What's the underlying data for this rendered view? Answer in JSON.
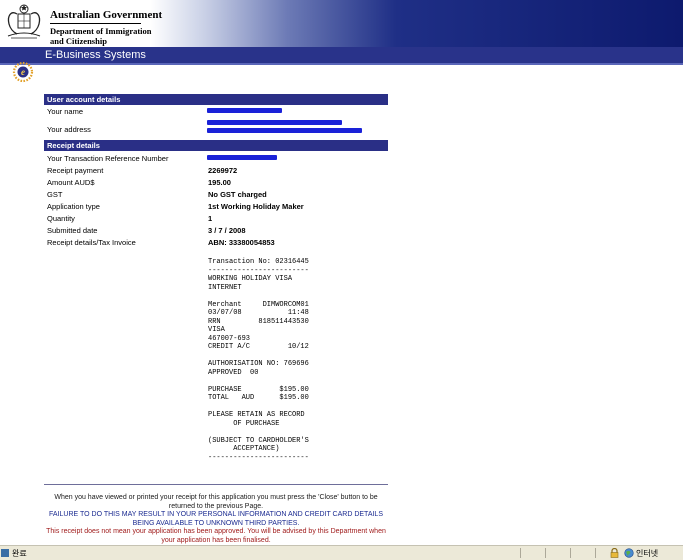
{
  "header": {
    "gov_line1": "Australian Government",
    "gov_line2a": "Department of Immigration",
    "gov_line2b": "and Citizenship",
    "system_title": "E-Business Systems"
  },
  "account": {
    "title": "User account details",
    "name_label": "Your name",
    "address_label": "Your address"
  },
  "receipt": {
    "title": "Receipt details",
    "rows": [
      {
        "label": "Your Transaction Reference Number",
        "value": ""
      },
      {
        "label": "Receipt payment",
        "value": "2269972"
      },
      {
        "label": "Amount AUD$",
        "value": "195.00"
      },
      {
        "label": "GST",
        "value": "No GST charged"
      },
      {
        "label": "Application type",
        "value": "1st Working Holiday Maker"
      },
      {
        "label": "Quantity",
        "value": "1"
      },
      {
        "label": "Submitted date",
        "value": "3 / 7 / 2008"
      },
      {
        "label": "Receipt details/Tax Invoice",
        "value": "ABN: 33380054853"
      }
    ],
    "text": "Transaction No: 02316445\n------------------------\nWORKING HOLIDAY VISA\nINTERNET\n\nMerchant     DIMWORCOM01\n03/07/08           11:48\nRRN         818511443530\nVISA\n467007-693\nCREDIT A/C         10/12\n\nAUTHORISATION NO: 769696\nAPPROVED  00\n\nPURCHASE         $195.00\nTOTAL   AUD      $195.00\n\nPLEASE RETAIN AS RECORD\n      OF PURCHASE\n\n(SUBJECT TO CARDHOLDER'S\n      ACCEPTANCE)\n------------------------"
  },
  "notice": {
    "line1": "When you have viewed or printed your receipt for this application you must press the 'Close' button to be returned to the previous Page.",
    "line2": "FAILURE TO DO THIS MAY RESULT IN YOUR PERSONAL INFORMATION AND CREDIT CARD DETAILS BEING AVAILABLE TO UNKNOWN THIRD PARTIES.",
    "line3": "This receipt does not mean your application has been approved. You will be advised by this Department when your application has been finalised."
  },
  "statusbar": {
    "status": "완료",
    "zone": "인터넷"
  },
  "colors": {
    "section_header": "#2a2f86",
    "bar": "#29338a",
    "redaction": "#1a22d8"
  }
}
